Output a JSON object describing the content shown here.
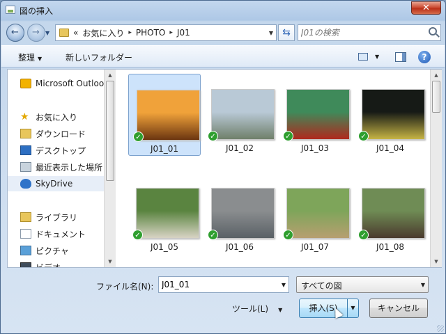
{
  "window": {
    "title": "図の挿入",
    "close_glyph": "✕"
  },
  "nav": {
    "back_glyph": "←",
    "forward_glyph": "→",
    "breadcrumbs": [
      "«",
      "お気に入り",
      "PHOTO",
      "J01"
    ],
    "crumb_sep": "▸",
    "refresh_glyph": "⇆",
    "search_placeholder": "J01の検索"
  },
  "toolbar": {
    "organize": "整理",
    "new_folder": "新しいフォルダー",
    "help_glyph": "?"
  },
  "sidebar": {
    "items": [
      {
        "label": "Microsoft Outlook",
        "icon": "outlook-icon"
      },
      {
        "label": "お気に入り",
        "icon": "favorites-star-icon"
      },
      {
        "label": "ダウンロード",
        "icon": "downloads-icon"
      },
      {
        "label": "デスクトップ",
        "icon": "desktop-icon"
      },
      {
        "label": "最近表示した場所",
        "icon": "recent-places-icon"
      },
      {
        "label": "SkyDrive",
        "icon": "skydrive-cloud-icon"
      },
      {
        "label": "ライブラリ",
        "icon": "libraries-icon"
      },
      {
        "label": "ドキュメント",
        "icon": "documents-icon"
      },
      {
        "label": "ピクチャ",
        "icon": "pictures-icon"
      },
      {
        "label": "ビデオ",
        "icon": "videos-icon"
      }
    ]
  },
  "files": [
    {
      "name": "J01_01",
      "colors": [
        "#f0a23a",
        "#6b3510"
      ]
    },
    {
      "name": "J01_02",
      "colors": [
        "#b9c9d6",
        "#6f7f6a"
      ]
    },
    {
      "name": "J01_03",
      "colors": [
        "#3f8a5a",
        "#b0281d"
      ]
    },
    {
      "name": "J01_04",
      "colors": [
        "#161a16",
        "#c6b444"
      ]
    },
    {
      "name": "J01_05",
      "colors": [
        "#5a8440",
        "#d8d3c4"
      ]
    },
    {
      "name": "J01_06",
      "colors": [
        "#8a8d8f",
        "#5a6166"
      ]
    },
    {
      "name": "J01_07",
      "colors": [
        "#7ea55a",
        "#b79f70"
      ]
    },
    {
      "name": "J01_08",
      "colors": [
        "#6f8c55",
        "#4b3a2e"
      ]
    },
    {
      "name": "",
      "colors": [
        "#b43a26",
        "#d07a56"
      ]
    },
    {
      "name": "",
      "colors": [
        "#5a6a4c",
        "#8f9482"
      ]
    },
    {
      "name": "",
      "colors": [
        "#8c7e70",
        "#b4a892"
      ]
    },
    {
      "name": "",
      "colors": [
        "#5b80c0",
        "#9fb8de"
      ]
    }
  ],
  "bottom": {
    "filename_label": "ファイル名(N):",
    "filename_value": "J01_01",
    "filter_value": "すべての図",
    "tools_label": "ツール(L)",
    "insert_label": "挿入(S)",
    "cancel_label": "キャンセル"
  }
}
